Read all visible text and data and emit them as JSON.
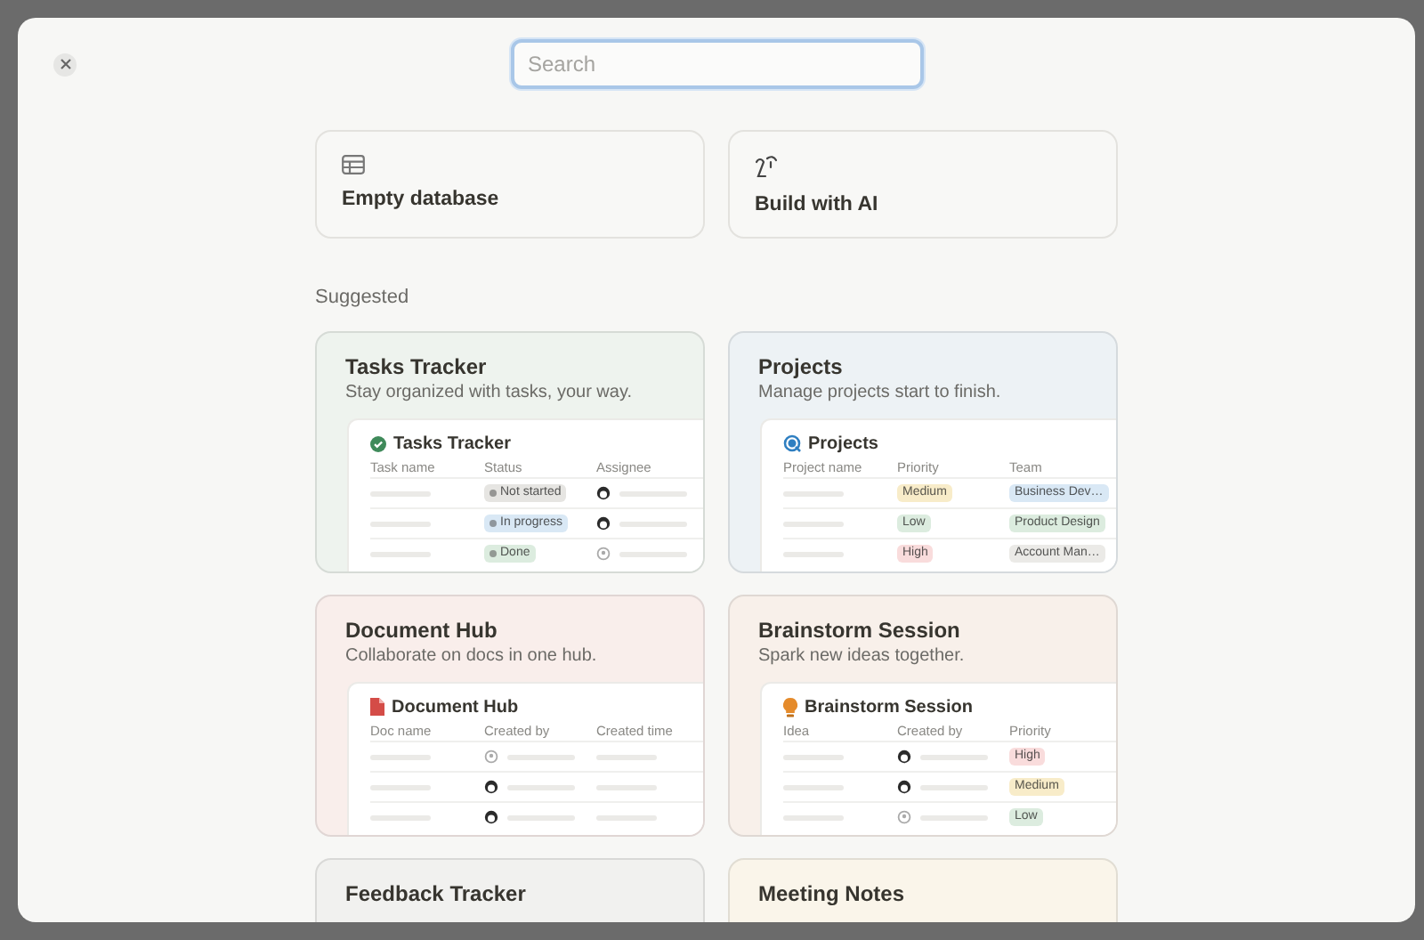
{
  "search": {
    "placeholder": "Search"
  },
  "create_options": [
    {
      "kind": "database",
      "label": "Empty database"
    },
    {
      "kind": "ai",
      "label": "Build with AI"
    }
  ],
  "section_heading": "Suggested",
  "templates": [
    {
      "kind": "tasks",
      "title": "Tasks Tracker",
      "description": "Stay organized with tasks, your way.",
      "color": "#eef3ee",
      "preview": {
        "title": "Tasks Tracker",
        "columns": [
          "Task name",
          "Status",
          "Assignee"
        ],
        "rows": [
          [
            {
              "kind": "line"
            },
            {
              "kind": "status",
              "text": "Not started",
              "color": "#e6e5e2"
            },
            {
              "kind": "person",
              "filled": true
            }
          ],
          [
            {
              "kind": "line"
            },
            {
              "kind": "status",
              "text": "In progress",
              "color": "#d9e8f5"
            },
            {
              "kind": "person",
              "filled": true
            }
          ],
          [
            {
              "kind": "line"
            },
            {
              "kind": "status",
              "text": "Done",
              "color": "#dcecdf"
            },
            {
              "kind": "person",
              "filled": false
            }
          ]
        ]
      }
    },
    {
      "kind": "projects",
      "title": "Projects",
      "description": "Manage projects start to finish.",
      "color": "#edf2f5",
      "preview": {
        "title": "Projects",
        "columns": [
          "Project name",
          "Priority",
          "Team"
        ],
        "rows": [
          [
            {
              "kind": "line"
            },
            {
              "kind": "tag",
              "text": "Medium",
              "color": "#f8ecc9"
            },
            {
              "kind": "tag",
              "text": "Business Dev…",
              "color": "#d9e8f5"
            }
          ],
          [
            {
              "kind": "line"
            },
            {
              "kind": "tag",
              "text": "Low",
              "color": "#dcecdf"
            },
            {
              "kind": "tag",
              "text": "Product Design",
              "color": "#dcecdf"
            }
          ],
          [
            {
              "kind": "line"
            },
            {
              "kind": "tag",
              "text": "High",
              "color": "#f9dcdc"
            },
            {
              "kind": "tag",
              "text": "Account Man…",
              "color": "#ebeae7"
            }
          ]
        ]
      }
    },
    {
      "kind": "docs",
      "title": "Document Hub",
      "description": "Collaborate on docs in one hub.",
      "color": "#f9eeeb",
      "preview": {
        "title": "Document Hub",
        "columns": [
          "Doc name",
          "Created by",
          "Created time"
        ],
        "rows": [
          [
            {
              "kind": "line"
            },
            {
              "kind": "person",
              "filled": false
            },
            {
              "kind": "line"
            }
          ],
          [
            {
              "kind": "line"
            },
            {
              "kind": "person",
              "filled": true
            },
            {
              "kind": "line"
            }
          ],
          [
            {
              "kind": "line"
            },
            {
              "kind": "person",
              "filled": true
            },
            {
              "kind": "line"
            }
          ]
        ]
      }
    },
    {
      "kind": "brainstorm",
      "title": "Brainstorm Session",
      "description": "Spark new ideas together.",
      "color": "#f8f0ea",
      "preview": {
        "title": "Brainstorm Session",
        "columns": [
          "Idea",
          "Created by",
          "Priority"
        ],
        "rows": [
          [
            {
              "kind": "line"
            },
            {
              "kind": "person",
              "filled": true
            },
            {
              "kind": "tag",
              "text": "High",
              "color": "#f9dcdc"
            }
          ],
          [
            {
              "kind": "line"
            },
            {
              "kind": "person",
              "filled": true
            },
            {
              "kind": "tag",
              "text": "Medium",
              "color": "#f8ecc9"
            }
          ],
          [
            {
              "kind": "line"
            },
            {
              "kind": "person",
              "filled": false
            },
            {
              "kind": "tag",
              "text": "Low",
              "color": "#dcecdf"
            }
          ]
        ]
      }
    },
    {
      "title": "Feedback Tracker",
      "color": "#f1f1ef"
    },
    {
      "title": "Meeting Notes",
      "color": "#faf5ea"
    }
  ]
}
